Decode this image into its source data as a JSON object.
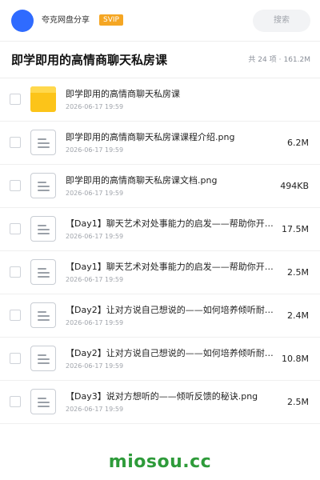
{
  "header": {
    "share_name": "夸克网盘分享",
    "badge": "SVIP",
    "search_label": "搜索",
    "avatar_color": "#2f6bff",
    "badge_color": "#f5a623"
  },
  "folder": {
    "title": "即学即用的高情商聊天私房课",
    "item_count": "共 24 项",
    "total_size": "161.2M",
    "separator": "·"
  },
  "files": [
    {
      "type": "folder",
      "icon": "folder-icon",
      "name": "即学即用的高情商聊天私房课",
      "date": "2026-06-17 19:59",
      "size": ""
    },
    {
      "type": "file",
      "icon": "document-icon",
      "name": "即学即用的高情商聊天私房课课程介绍.png",
      "date": "2026-06-17 19:59",
      "size": "6.2M"
    },
    {
      "type": "file",
      "icon": "document-icon",
      "name": "即学即用的高情商聊天私房课文档.png",
      "date": "2026-06-17 19:59",
      "size": "494KB"
    },
    {
      "type": "file",
      "icon": "document-icon",
      "name": "【Day1】聊天艺术对处事能力的启发——帮助你开拓…",
      "date": "2026-06-17 19:59",
      "size": "17.5M"
    },
    {
      "type": "file",
      "icon": "document-icon",
      "name": "【Day1】聊天艺术对处事能力的启发——帮助你开拓…",
      "date": "2026-06-17 19:59",
      "size": "2.5M"
    },
    {
      "type": "file",
      "icon": "document-icon",
      "name": "【Day2】让对方说自己想说的——如何培养倾听耐力…",
      "date": "2026-06-17 19:59",
      "size": "2.4M"
    },
    {
      "type": "file",
      "icon": "document-icon",
      "name": "【Day2】让对方说自己想说的——如何培养倾听耐力…",
      "date": "2026-06-17 19:59",
      "size": "10.8M"
    },
    {
      "type": "file",
      "icon": "document-icon",
      "name": "【Day3】说对方想听的——倾听反馈的秘诀.png",
      "date": "2026-06-17 19:59",
      "size": "2.5M"
    }
  ],
  "watermark": "miosou.cc",
  "watermark_color": "#2e9b3a"
}
